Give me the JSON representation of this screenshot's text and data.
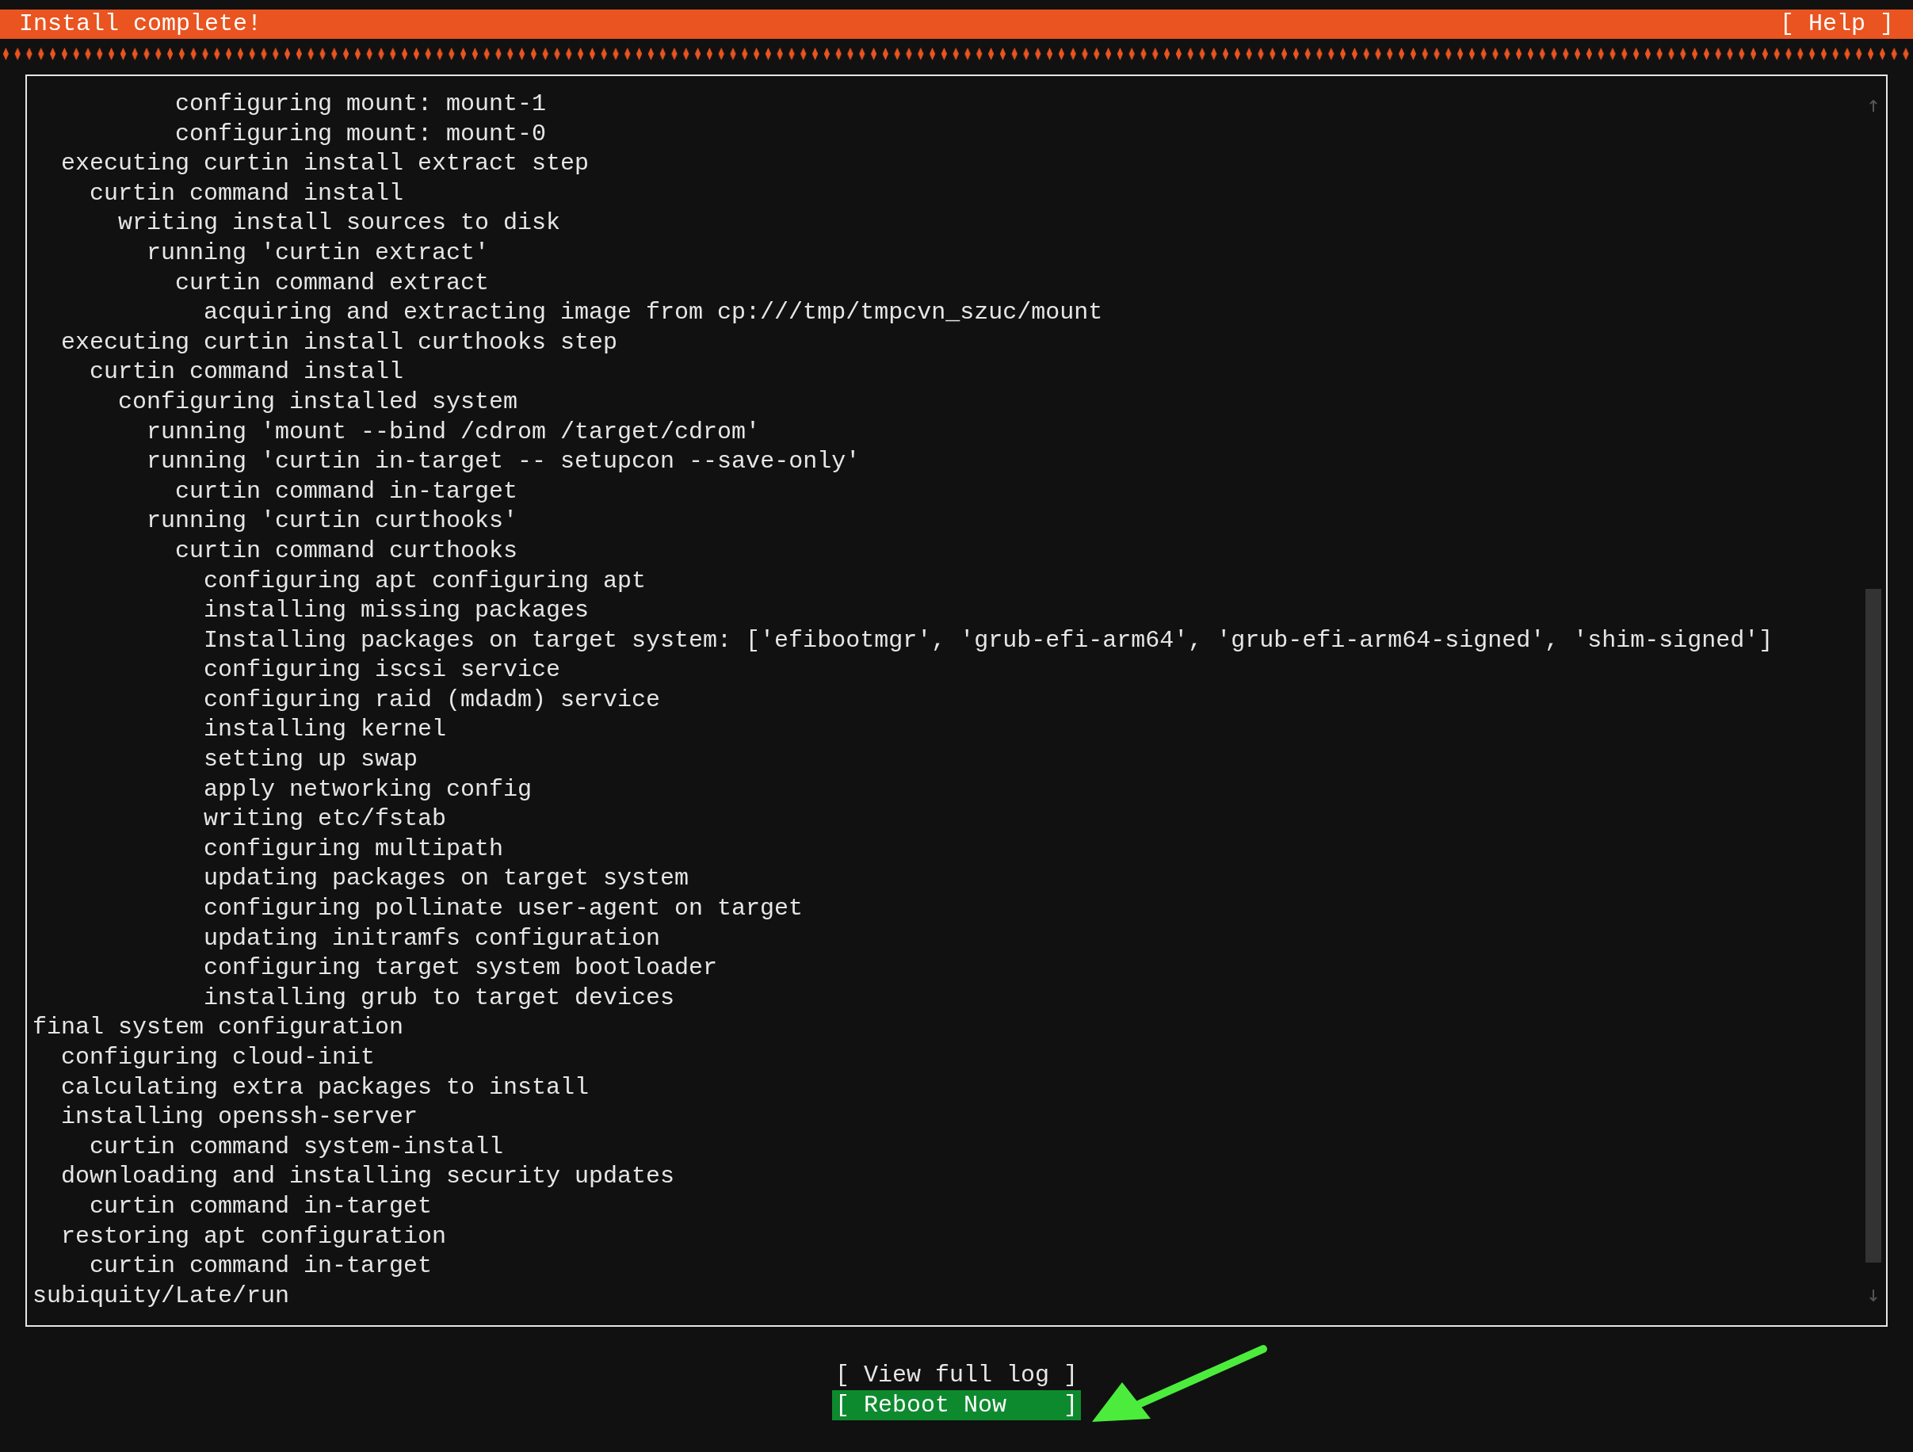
{
  "header": {
    "title": "Install complete!",
    "help": "[ Help ]"
  },
  "log_lines": [
    {
      "children": [
        {
          "children": [
            {
              "children": [
                {
                  "children": [
                    {
                      "children": [
                        {
                          "text": "configuring mount: mount-1"
                        },
                        {
                          "text": "configuring mount: mount-0"
                        }
                      ]
                    }
                  ]
                }
              ]
            }
          ]
        },
        {
          "text": "executing curtin install extract step",
          "children": [
            {
              "text": "curtin command install",
              "children": [
                {
                  "text": "writing install sources to disk",
                  "children": [
                    {
                      "text": "running 'curtin extract'",
                      "children": [
                        {
                          "text": "curtin command extract",
                          "children": [
                            {
                              "text": "acquiring and extracting image from cp:///tmp/tmpcvn_szuc/mount"
                            }
                          ]
                        }
                      ]
                    }
                  ]
                }
              ]
            }
          ]
        },
        {
          "text": "executing curtin install curthooks step",
          "children": [
            {
              "text": "curtin command install",
              "children": [
                {
                  "text": "configuring installed system",
                  "children": [
                    {
                      "text": "running 'mount --bind /cdrom /target/cdrom'"
                    },
                    {
                      "text": "running 'curtin in-target -- setupcon --save-only'",
                      "children": [
                        {
                          "text": "curtin command in-target"
                        }
                      ]
                    },
                    {
                      "text": "running 'curtin curthooks'",
                      "children": [
                        {
                          "text": "curtin command curthooks",
                          "children": [
                            {
                              "text": "configuring apt configuring apt"
                            },
                            {
                              "text": "installing missing packages"
                            },
                            {
                              "text": "Installing packages on target system: ['efibootmgr', 'grub-efi-arm64', 'grub-efi-arm64-signed', 'shim-signed']"
                            },
                            {
                              "text": "configuring iscsi service"
                            },
                            {
                              "text": "configuring raid (mdadm) service"
                            },
                            {
                              "text": "installing kernel"
                            },
                            {
                              "text": "setting up swap"
                            },
                            {
                              "text": "apply networking config"
                            },
                            {
                              "text": "writing etc/fstab"
                            },
                            {
                              "text": "configuring multipath"
                            },
                            {
                              "text": "updating packages on target system"
                            },
                            {
                              "text": "configuring pollinate user-agent on target"
                            },
                            {
                              "text": "updating initramfs configuration"
                            },
                            {
                              "text": "configuring target system bootloader"
                            },
                            {
                              "text": "installing grub to target devices"
                            }
                          ]
                        }
                      ]
                    }
                  ]
                }
              ]
            }
          ]
        }
      ]
    },
    {
      "text": "final system configuration",
      "children": [
        {
          "text": "configuring cloud-init"
        },
        {
          "text": "calculating extra packages to install"
        },
        {
          "text": "installing openssh-server",
          "children": [
            {
              "text": "curtin command system-install"
            }
          ]
        },
        {
          "text": "downloading and installing security updates",
          "children": [
            {
              "text": "curtin command in-target"
            }
          ]
        },
        {
          "text": "restoring apt configuration",
          "children": [
            {
              "text": "curtin command in-target"
            }
          ]
        }
      ]
    },
    {
      "text": "subiquity/Late/run"
    }
  ],
  "buttons": [
    {
      "label": "[ View full log ]",
      "selected": false
    },
    {
      "label": "[ Reboot Now    ]",
      "selected": true
    }
  ]
}
